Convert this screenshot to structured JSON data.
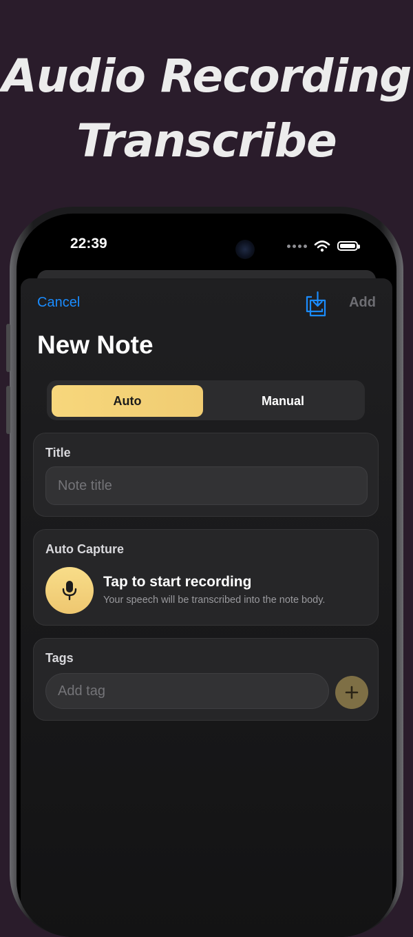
{
  "headline": {
    "line1": "Audio Recording",
    "line2": "Transcribe"
  },
  "status_bar": {
    "time": "22:39"
  },
  "nav": {
    "cancel_label": "Cancel",
    "add_label": "Add",
    "import_icon": "tray-download-icon"
  },
  "page": {
    "title": "New Note"
  },
  "mode_toggle": {
    "options": [
      "Auto",
      "Manual"
    ],
    "selected": "Auto"
  },
  "title_section": {
    "label": "Title",
    "placeholder": "Note title"
  },
  "auto_capture": {
    "label": "Auto Capture",
    "prompt": "Tap to start recording",
    "description": "Your speech will be transcribed into the note body."
  },
  "tags_section": {
    "label": "Tags",
    "placeholder": "Add tag"
  },
  "colors": {
    "background": "#2a1c2b",
    "accent_gold": "#f2cf75",
    "link_blue": "#1a8cff",
    "card": "#262628"
  }
}
